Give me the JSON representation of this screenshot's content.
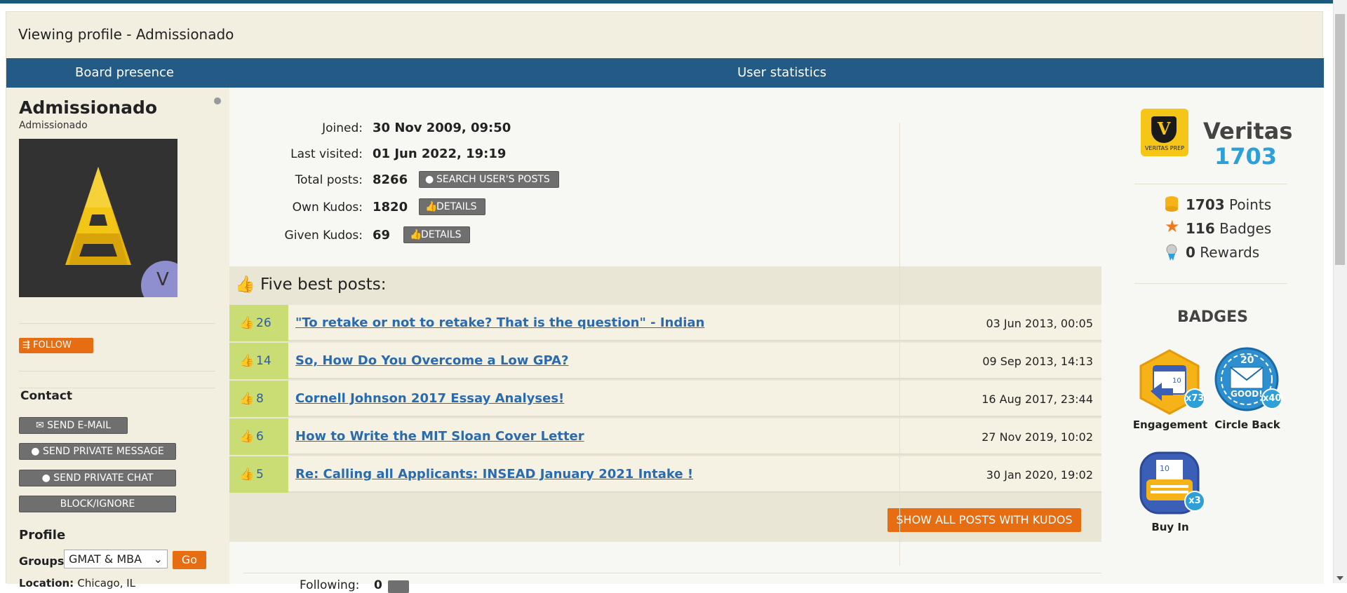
{
  "page": {
    "title": "Viewing profile - Admissionado"
  },
  "header": {
    "left": "Board presence",
    "center": "User statistics"
  },
  "sidebar": {
    "username": "Admissionado",
    "rank": "Admissionado",
    "avatar_letter": "V",
    "follow_label": "FOLLOW",
    "contact_heading": "Contact",
    "send_email": "SEND E-MAIL",
    "send_pm": "SEND PRIVATE MESSAGE",
    "send_chat": "SEND PRIVATE CHAT",
    "block": "BLOCK/IGNORE",
    "profile_heading": "Profile",
    "groups_label": "Groups:",
    "groups_value": "GMAT & MBA",
    "go_label": "Go",
    "location_label": "Location:",
    "location_value": "Chicago, IL"
  },
  "stats": {
    "joined_label": "Joined:",
    "joined_value": "30 Nov 2009, 09:50",
    "visited_label": "Last visited:",
    "visited_value": "01 Jun 2022, 19:19",
    "posts_label": "Total posts:",
    "posts_value": "8266",
    "search_posts": "SEARCH USER'S POSTS",
    "own_label": "Own Kudos:",
    "own_value": "1820",
    "details1": "DETAILS",
    "given_label": "Given Kudos:",
    "given_value": "69",
    "details2": "DETAILS"
  },
  "best_posts": {
    "heading": "Five best posts:",
    "rows": [
      {
        "kudos": "26",
        "title": "\"To retake or not to retake? That is the question\" - Indian",
        "date": "03 Jun 2013, 00:05"
      },
      {
        "kudos": "14",
        "title": "So, How Do You Overcome a Low GPA?",
        "date": "09 Sep 2013, 14:13"
      },
      {
        "kudos": "8",
        "title": "Cornell Johnson 2017 Essay Analyses!",
        "date": "16 Aug 2017, 23:44"
      },
      {
        "kudos": "6",
        "title": "How to Write the MIT Sloan Cover Letter",
        "date": "27 Nov 2019, 10:02"
      },
      {
        "kudos": "5",
        "title": "Re: Calling all Applicants: INSEAD January 2021 Intake !",
        "date": "30 Jan 2020, 19:02"
      }
    ],
    "show_all": "SHOW ALL POSTS WITH KUDOS"
  },
  "following": {
    "label": "Following:",
    "value": "0"
  },
  "veritas": {
    "logo_text": "VERITAS PREP",
    "name": "Veritas",
    "score": "1703",
    "points_value": "1703",
    "points_label": "Points",
    "badges_value": "116",
    "badges_label": "Badges",
    "rewards_value": "0",
    "rewards_label": "Rewards",
    "badges_heading": "BADGES",
    "badge1": {
      "name": "Engagement",
      "count": "x73",
      "inner": "10"
    },
    "badge2": {
      "name": "Circle Back",
      "count": "x40",
      "inner": "20",
      "text": "GOOD!"
    },
    "badge3": {
      "name": "Buy In",
      "count": "x3",
      "inner": "10"
    }
  },
  "colors": {
    "accent": "#e66d12",
    "header": "#245a86",
    "link": "#2a6bb0",
    "kudos_bg": "#c9dd74",
    "score": "#2ea0d8"
  }
}
